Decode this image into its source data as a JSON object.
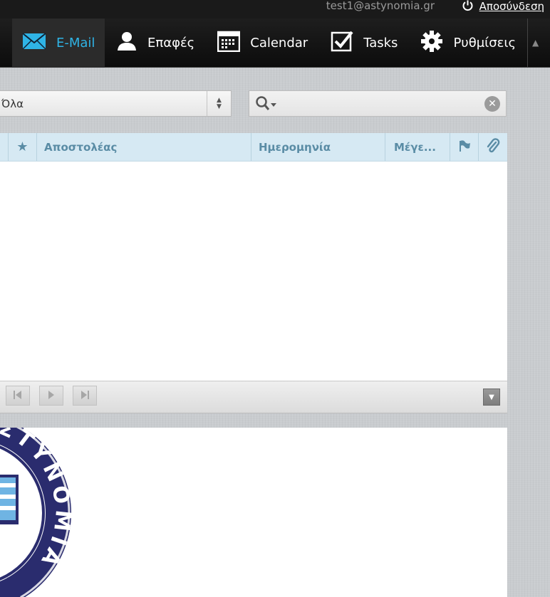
{
  "header": {
    "user_email": "test1@astynomia.gr",
    "logout_label": "Αποσύνδεση"
  },
  "nav": {
    "items": [
      {
        "label": "E-Mail",
        "icon": "envelope-icon",
        "active": true
      },
      {
        "label": "Επαφές",
        "icon": "person-icon",
        "active": false
      },
      {
        "label": "Calendar",
        "icon": "calendar-icon",
        "active": false
      },
      {
        "label": "Tasks",
        "icon": "checkbox-icon",
        "active": false
      },
      {
        "label": "Ρυθμίσεις",
        "icon": "gear-icon",
        "active": false
      }
    ]
  },
  "filter": {
    "selected": "Όλα"
  },
  "search": {
    "value": ""
  },
  "list": {
    "columns": {
      "sender": "Αποστολέας",
      "date": "Ημερομηνία",
      "size": "Μέγε..."
    },
    "rows": []
  },
  "preview": {
    "emblem_text": "ΑΣΤΥΝΟΜΙΑ"
  },
  "colors": {
    "accent": "#2fb4e6",
    "header_bg": "#d6e9f3",
    "header_text": "#5a8ca5",
    "emblem_navy": "#2a2c6e"
  }
}
